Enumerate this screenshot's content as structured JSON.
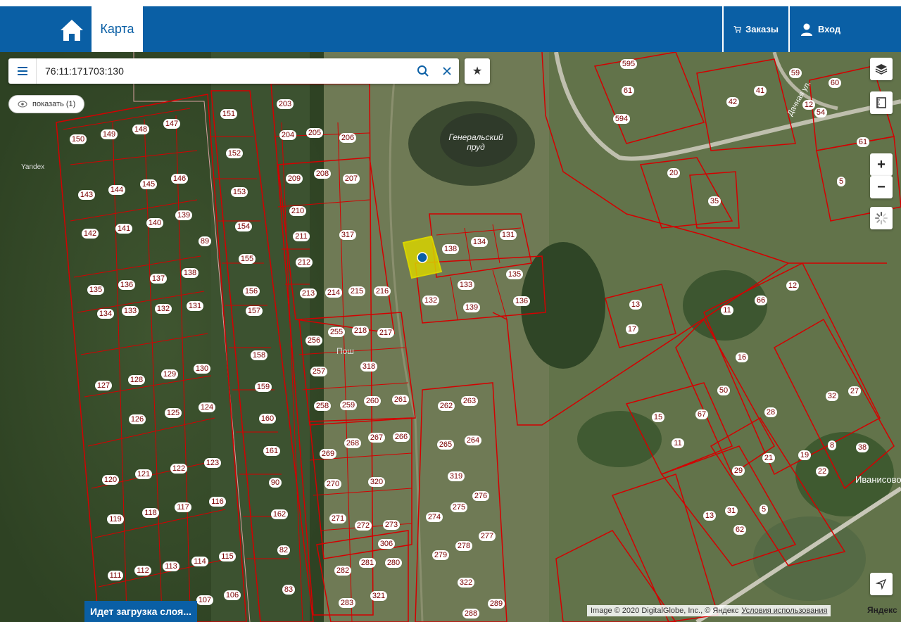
{
  "header": {
    "map_tab": "Карта",
    "orders": "Заказы",
    "login": "Вход"
  },
  "search": {
    "value": "76:11:171703:130"
  },
  "show_button": "показать (1)",
  "loading": "Идет загрузка слоя...",
  "footer": {
    "copyright": "Image © 2020 DigitalGlobe, Inc., © Яндекс",
    "terms": "Условия использования",
    "yandex": "Яндекс"
  },
  "map_labels": {
    "pond": "Генеральский пруд",
    "village": "Иванисово",
    "street_dachnaya": "Дачная ул.",
    "pos": "Пош",
    "yandex": "Yandex"
  },
  "colors": {
    "header": "#0a5fa5",
    "parcel": "#d40000",
    "selected": "#d8d400",
    "map_bg": "#5d6f40"
  },
  "plots": [
    "151",
    "150",
    "149",
    "148",
    "147",
    "152",
    "143",
    "144",
    "145",
    "146",
    "153",
    "142",
    "141",
    "140",
    "139",
    "154",
    "89",
    "155",
    "135",
    "136",
    "137",
    "138",
    "156",
    "134",
    "133",
    "132",
    "131",
    "157",
    "158",
    "127",
    "128",
    "129",
    "130",
    "159",
    "126",
    "125",
    "124",
    "160",
    "161",
    "120",
    "121",
    "122",
    "123",
    "90",
    "119",
    "118",
    "117",
    "116",
    "162",
    "82",
    "111",
    "112",
    "113",
    "114",
    "115",
    "107",
    "106",
    "83",
    "203",
    "204",
    "205",
    "206",
    "209",
    "208",
    "207",
    "210",
    "211",
    "212",
    "317",
    "213",
    "214",
    "215",
    "216",
    "256",
    "255",
    "218",
    "217",
    "318",
    "257",
    "258",
    "259",
    "260",
    "261",
    "269",
    "268",
    "267",
    "266",
    "270",
    "320",
    "271",
    "272",
    "273",
    "306",
    "282",
    "281",
    "280",
    "283",
    "321",
    "262",
    "263",
    "265",
    "264",
    "319",
    "274",
    "275",
    "276",
    "279",
    "278",
    "277",
    "322",
    "289",
    "288",
    "138",
    "134",
    "131",
    "135",
    "133",
    "132",
    "139",
    "136",
    "595",
    "61",
    "594",
    "42",
    "41",
    "59",
    "60",
    "12",
    "54",
    "20",
    "35",
    "5",
    "61",
    "13",
    "17",
    "12",
    "66",
    "11",
    "16",
    "50",
    "28",
    "32",
    "27",
    "15",
    "67",
    "11",
    "29",
    "21",
    "19",
    "8",
    "38",
    "22",
    "13",
    "31",
    "5",
    "62"
  ]
}
